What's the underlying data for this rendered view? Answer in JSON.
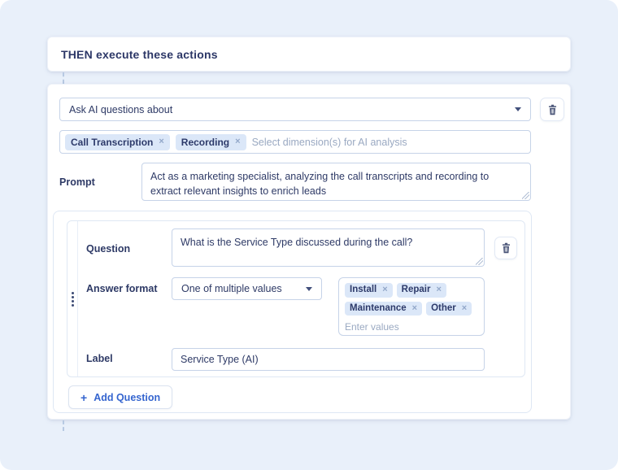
{
  "header": {
    "title": "THEN execute these actions"
  },
  "action": {
    "type_select": {
      "value": "Ask AI questions about"
    },
    "dimensions": {
      "tags": [
        "Call Transcription",
        "Recording"
      ],
      "placeholder": "Select dimension(s) for AI analysis"
    },
    "prompt": {
      "label": "Prompt",
      "value": "Act as a marketing specialist, analyzing the call transcripts and recording to extract relevant insights to enrich leads"
    }
  },
  "questions": [
    {
      "question": {
        "label": "Question",
        "value": "What is the Service Type discussed during the call?"
      },
      "answer_format": {
        "label": "Answer format",
        "value": "One of multiple values"
      },
      "values": {
        "tags": [
          "Install",
          "Repair",
          "Maintenance",
          "Other"
        ],
        "placeholder": "Enter values"
      },
      "field_label": {
        "label": "Label",
        "value": "Service Type (AI)"
      }
    }
  ],
  "add_question": {
    "label": "Add Question"
  },
  "icons": {
    "remove": "×",
    "plus": "+"
  },
  "colors": {
    "page_background": "#e9f0fa",
    "card_background": "#ffffff",
    "text_navy": "#2e3a66",
    "accent_blue": "#3565cf",
    "tag_background": "#dbe7f8",
    "input_border": "#c6d3e8",
    "placeholder_gray": "#9aa9c2",
    "trash_icon": "#4a5578"
  }
}
